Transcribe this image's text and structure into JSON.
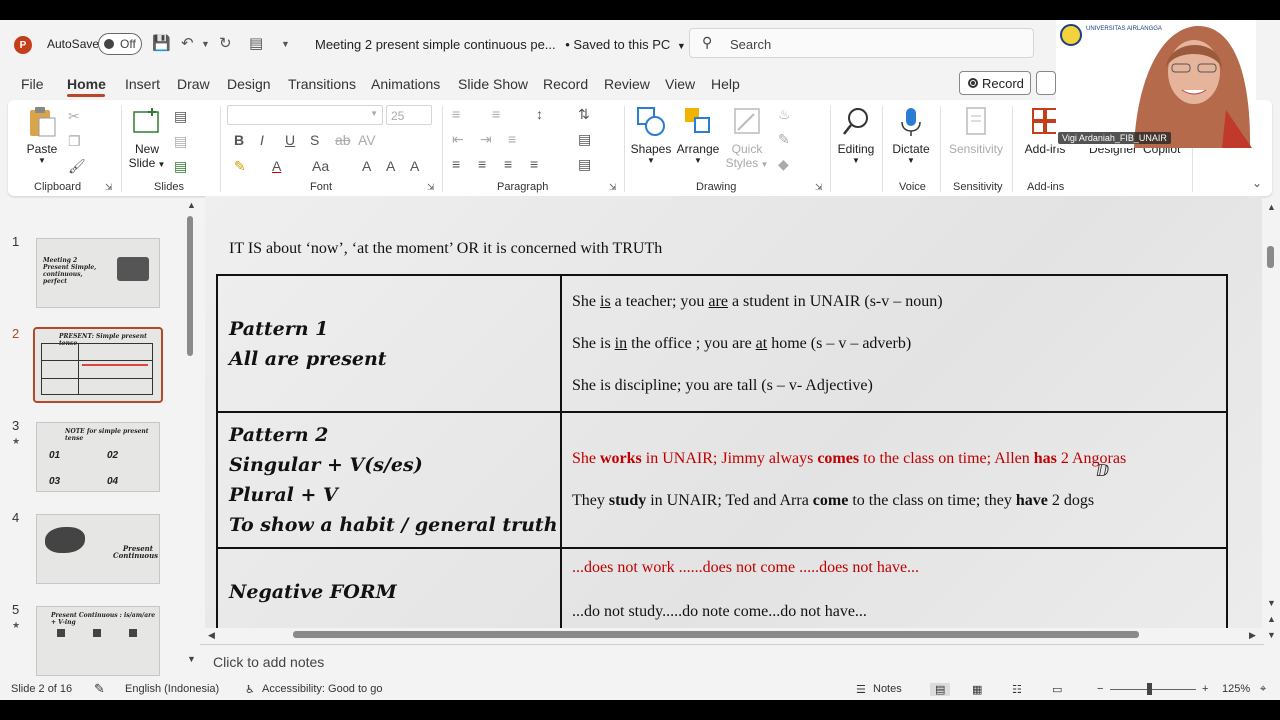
{
  "titlebar": {
    "app_logo": "P",
    "autosave_label": "AutoSave",
    "autosave_state": "Off",
    "doc_title": "Meeting 2 present simple continuous pe...",
    "save_status": "• Saved to this PC",
    "search_placeholder": "Search"
  },
  "menu": {
    "items": [
      "File",
      "Home",
      "Insert",
      "Draw",
      "Design",
      "Transitions",
      "Animations",
      "Slide Show",
      "Record",
      "Review",
      "View",
      "Help"
    ],
    "record_button": "Record"
  },
  "ribbon": {
    "clipboard": {
      "paste": "Paste",
      "label": "Clipboard"
    },
    "slides": {
      "new_slide": "New",
      "new_slide2": "Slide",
      "label": "Slides"
    },
    "font": {
      "label": "Font",
      "size": "25"
    },
    "paragraph": {
      "label": "Paragraph"
    },
    "drawing": {
      "shapes": "Shapes",
      "arrange": "Arrange",
      "quick_styles": "Quick",
      "quick_styles2": "Styles",
      "label": "Drawing"
    },
    "editing": {
      "label": "Editing"
    },
    "voice": {
      "dictate": "Dictate",
      "label": "Voice"
    },
    "sensitivity": {
      "button": "Sensitivity",
      "label": "Sensitivity"
    },
    "addins": {
      "button": "Add-ins",
      "label": "Add-ins",
      "designer": "Designer",
      "copilot": "Copilot"
    }
  },
  "thumbnails": [
    {
      "num": "1",
      "text": "Meeting 2 Present Simple, continuous, perfect"
    },
    {
      "num": "2",
      "text": "PRESENT: Simple present tense"
    },
    {
      "num": "3",
      "text": "NOTE for simple present tense"
    },
    {
      "num": "4",
      "text": "Present Continuous"
    },
    {
      "num": "5",
      "text": "Present Continuous : is/am/are + V-ing"
    }
  ],
  "slide": {
    "subtitle": "IT IS about ‘now’, ‘at the moment’   OR it is concerned with TRUTh",
    "rows": [
      {
        "left": [
          "Pattern 1",
          "All are present"
        ],
        "right": {
          "l1": [
            "She ",
            "is",
            " a teacher; you ",
            "are",
            " a student in UNAIR (s-v – noun)"
          ],
          "l2": [
            "She is ",
            "in",
            " the office ; you are ",
            "at",
            " home (s – v – adverb)"
          ],
          "l3": "She is discipline; you are tall (s – v- Adjective)"
        }
      },
      {
        "left": [
          "Pattern 2",
          "Singular + V(s/es)",
          "Plural + V",
          "To show a habit / general truth"
        ],
        "right": {
          "l1": [
            "She ",
            "works",
            " in UNAIR; Jimmy always ",
            "comes",
            " to the class on time; Allen ",
            "has",
            " 2 Angoras"
          ],
          "l2": [
            "They ",
            "study",
            " in UNAIR; Ted and Arra ",
            "come",
            " to the class on time; they ",
            "have",
            " 2 dogs"
          ]
        }
      },
      {
        "left": [
          "Negative FORM"
        ],
        "right": {
          "l1": "...does not work ......does not come .....does not have...",
          "l2": "...do not study.....do note come...do not have..."
        }
      }
    ]
  },
  "notes_placeholder": "Click to add notes",
  "status": {
    "slide_counter": "Slide 2 of 16",
    "language": "English (Indonesia)",
    "accessibility": "Accessibility: Good to go",
    "notes": "Notes",
    "zoom": "125%"
  },
  "webcam": {
    "name": "Vigi Ardaniah_FIB_UNAIR",
    "logo_text": "UNIVERSITAS AIRLANGGA"
  }
}
